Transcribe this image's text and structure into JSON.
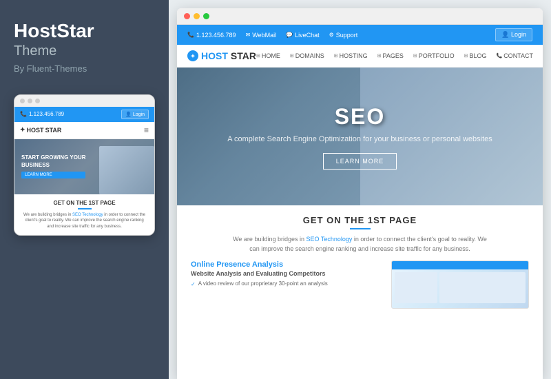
{
  "left": {
    "title": "HostStar",
    "subtitle": "Theme",
    "author": "By Fluent-Themes",
    "mobile": {
      "phone": "1.123.456.789",
      "login": "Login",
      "logo_blue": "HOST",
      "logo_dark": "STAR",
      "hero_title": "START GROWING YOUR",
      "hero_title2": "BUSINESS",
      "section_title": "GET ON THE 1ST PAGE",
      "desc_part1": "We are building bridges in ",
      "desc_seo": "SEO Technology",
      "desc_part2": " in order to connect the client's goal to reality. We can improve the search engine ranking and increase site traffic for any business."
    }
  },
  "right": {
    "window_dots": [
      "red",
      "yellow",
      "green"
    ],
    "topbar": {
      "phone": "1.123.456.789",
      "webmail": "WebMail",
      "livechat": "LiveChat",
      "support": "Support",
      "login": "Login"
    },
    "navbar": {
      "logo_blue": "HOST",
      "logo_dark": "STAR",
      "nav_items": [
        "HOME",
        "DOMAINS",
        "HOSTING",
        "PAGES",
        "PORTFOLIO",
        "BLOG",
        "CONTACT"
      ]
    },
    "hero": {
      "title": "SEO",
      "subtitle": "A complete Search Engine Optimization for your business or personal websites",
      "cta": "LEARN MORE"
    },
    "below": {
      "section_title": "GET ON THE 1ST PAGE",
      "desc_part1": "We are building bridges in ",
      "desc_seo": "SEO Technology",
      "desc_part2": " in order to connect the client's goal to reality. We can improve the search engine ranking and increase site traffic for any business.",
      "online_title_black": "Online ",
      "online_title_blue": "Presence Analysis",
      "sub_title": "Website Analysis and Evaluating Competitors",
      "list_items": [
        "A video review of our proprietary 30-point an analysis"
      ]
    }
  }
}
